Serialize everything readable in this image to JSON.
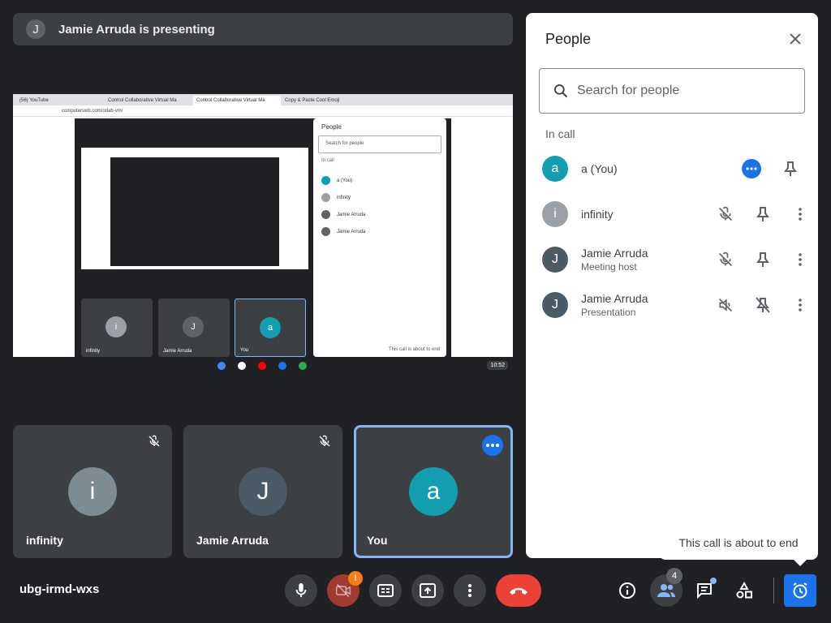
{
  "banner": {
    "avatar_letter": "J",
    "text": "Jamie Arruda is presenting"
  },
  "shared_screen": {
    "tabs": [
      "(56) YouTube",
      "Control Collaborative Virtual Ma",
      "Control Collaborative Virtual Ma",
      "Copy & Paste Cool Emoji"
    ],
    "address": "computerswb.com/odab-vm/",
    "inner_panel_title": "People",
    "inner_search_placeholder": "Search for people",
    "inner_section": "In call",
    "inner_rows": [
      {
        "letter": "a",
        "name": "a (You)",
        "color": "#129eaf"
      },
      {
        "letter": "i",
        "name": "infinity",
        "color": "#9aa0a6"
      },
      {
        "letter": "J",
        "name": "Jamie Arruda",
        "color": "#5f6368"
      },
      {
        "letter": "J",
        "name": "Jamie Arruda",
        "color": "#5f6368"
      }
    ],
    "inner_toast": "This call is about to end",
    "inner_tiles": [
      {
        "letter": "i",
        "name": "infinity",
        "color": "#9aa0a6"
      },
      {
        "letter": "J",
        "name": "Jamie Arruda",
        "color": "#5f6368"
      },
      {
        "letter": "a",
        "name": "You",
        "color": "#129eaf"
      }
    ],
    "clock": "10:52"
  },
  "tiles": [
    {
      "letter": "i",
      "name": "infinity",
      "color": "#7d8b93"
    },
    {
      "letter": "J",
      "name": "Jamie Arruda",
      "color": "#4b5b66"
    },
    {
      "letter": "a",
      "name": "You",
      "color": "#129eaf"
    }
  ],
  "panel": {
    "title": "People",
    "search_placeholder": "Search for people",
    "section": "In call",
    "people": [
      {
        "letter": "a",
        "name": "a (You)",
        "sub": "",
        "color": "#129eaf"
      },
      {
        "letter": "i",
        "name": "infinity",
        "sub": "",
        "color": "#9aa0a6"
      },
      {
        "letter": "J",
        "name": "Jamie Arruda",
        "sub": "Meeting host",
        "color": "#4b5b66"
      },
      {
        "letter": "J",
        "name": "Jamie Arruda",
        "sub": "Presentation",
        "color": "#4b5b66"
      }
    ]
  },
  "bottom": {
    "meeting_code": "ubg-irmd-wxs",
    "camera_warning": "!",
    "people_count": "4"
  },
  "tooltip": "This call is about to end",
  "colors": {
    "accent": "#1a73e8",
    "end_call": "#ea4335",
    "warning": "#fa7b17"
  }
}
